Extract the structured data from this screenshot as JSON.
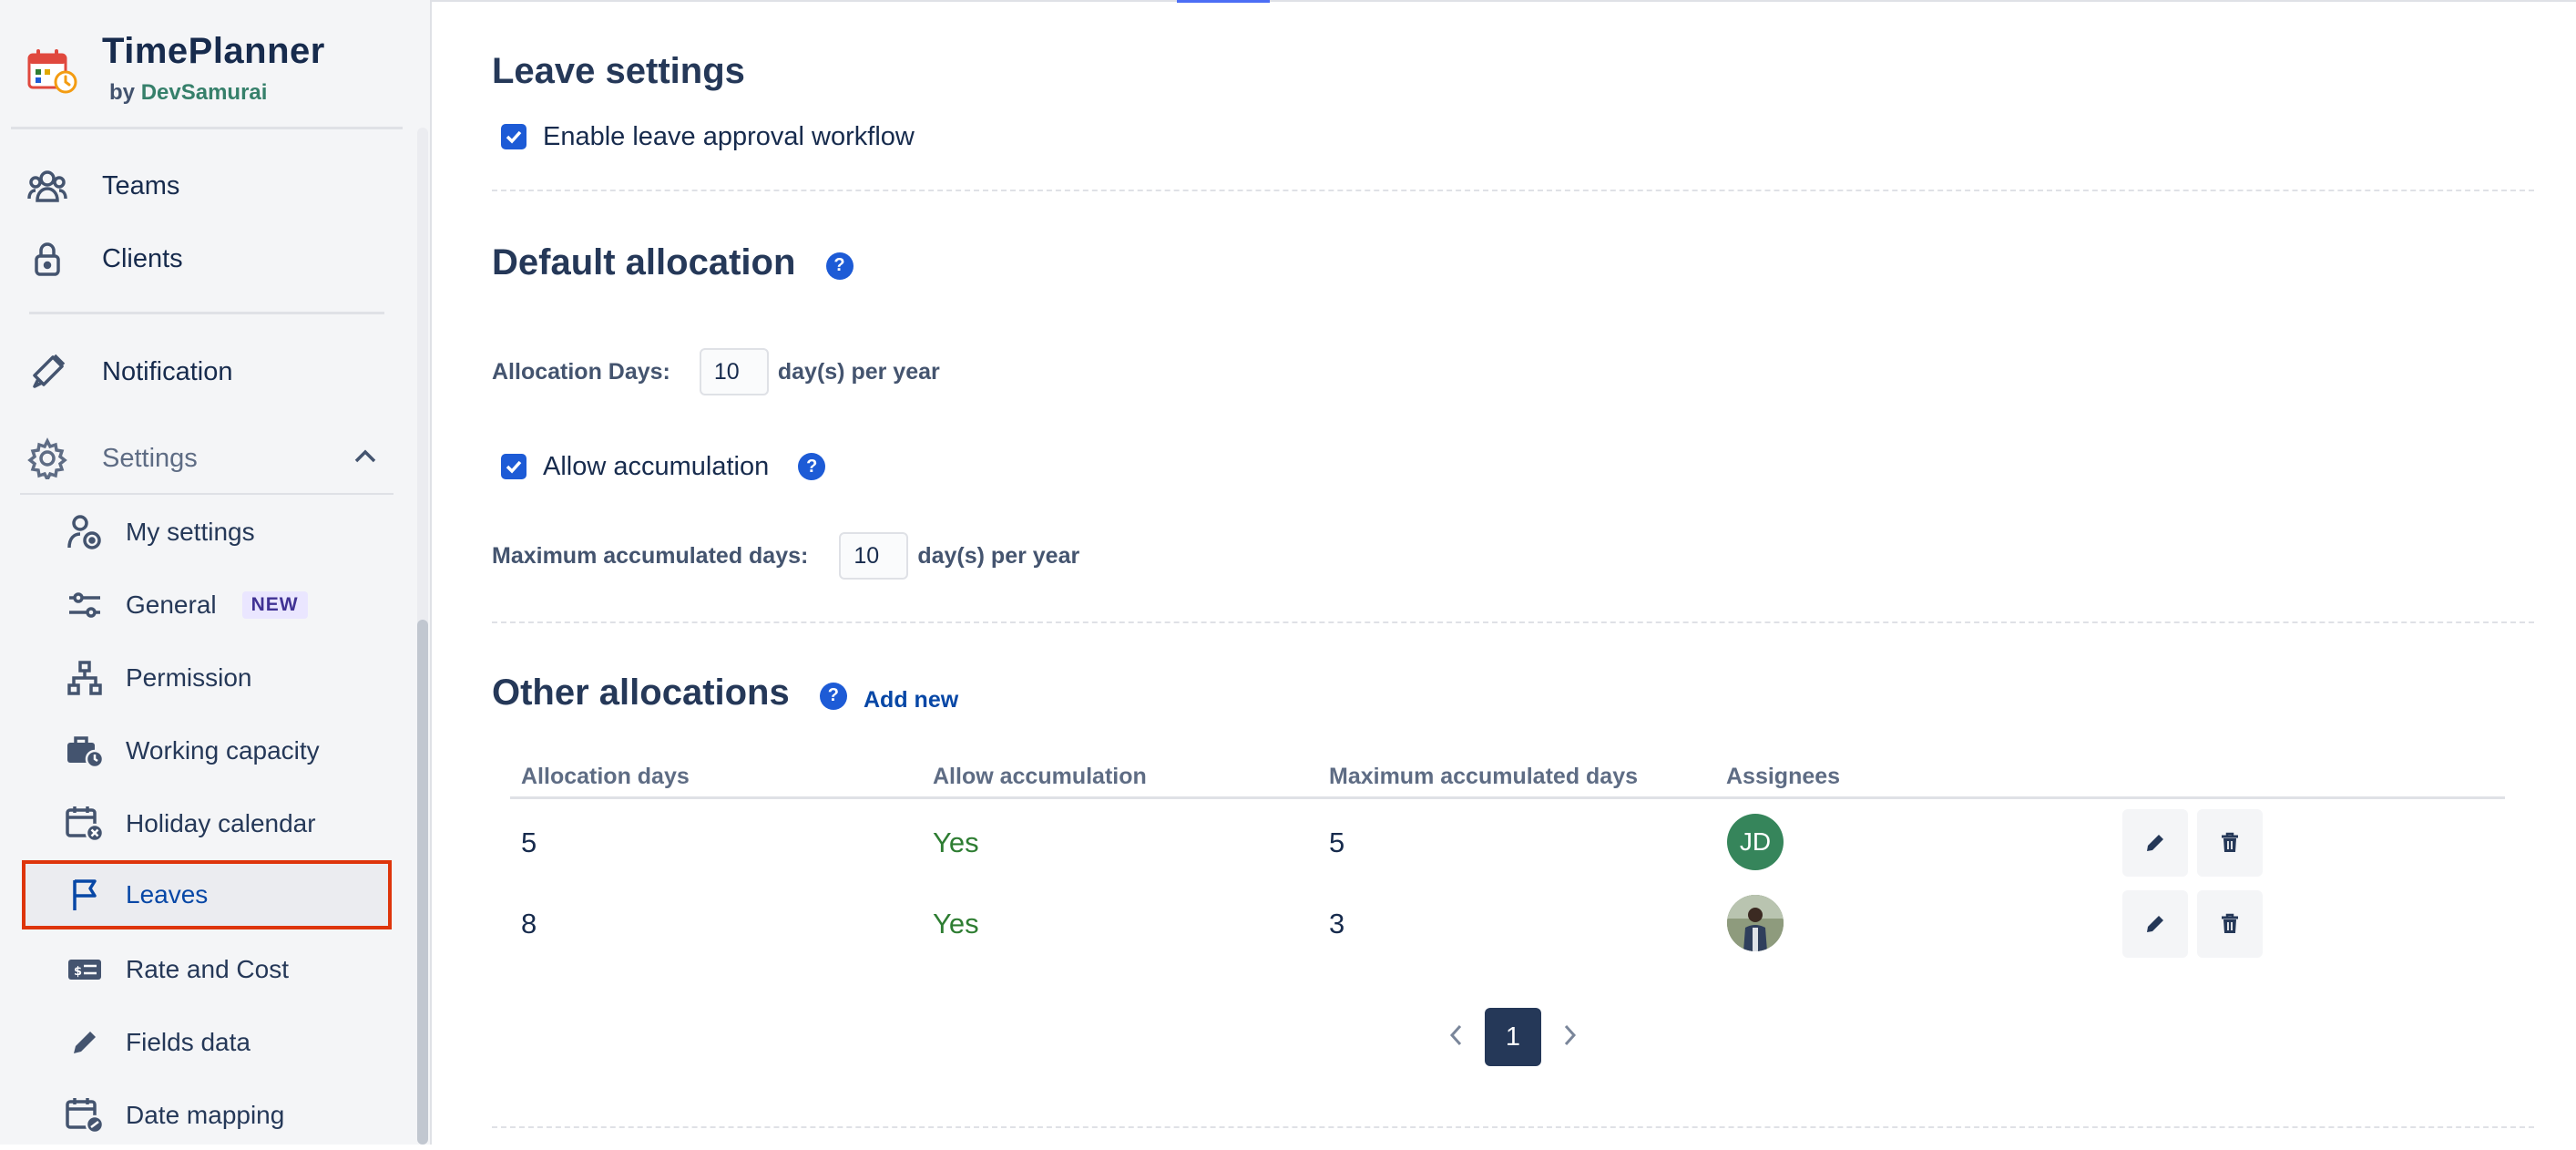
{
  "app": {
    "title": "TimePlanner",
    "by": "by",
    "vendor": "DevSamurai"
  },
  "sidebar": {
    "items": [
      {
        "label": "Teams",
        "icon": "teams-icon"
      },
      {
        "label": "Clients",
        "icon": "lock-icon"
      },
      {
        "label": "Notification",
        "icon": "megaphone-icon"
      },
      {
        "label": "Settings",
        "icon": "gear-icon",
        "expanded": true
      }
    ],
    "settings_items": [
      {
        "label": "My settings",
        "icon": "user-settings-icon"
      },
      {
        "label": "General",
        "icon": "sliders-icon",
        "badge": "NEW"
      },
      {
        "label": "Permission",
        "icon": "hierarchy-icon"
      },
      {
        "label": "Working capacity",
        "icon": "briefcase-clock-icon"
      },
      {
        "label": "Holiday calendar",
        "icon": "calendar-x-icon"
      },
      {
        "label": "Leaves",
        "icon": "flag-icon",
        "active": true
      },
      {
        "label": "Rate and Cost",
        "icon": "money-card-icon"
      },
      {
        "label": "Fields data",
        "icon": "pencil-icon"
      },
      {
        "label": "Date mapping",
        "icon": "calendar-link-icon"
      }
    ]
  },
  "leave_settings": {
    "title": "Leave settings",
    "approval_label": "Enable leave approval workflow",
    "approval_checked": true
  },
  "default_allocation": {
    "title": "Default allocation",
    "help": "?",
    "allocation_days_label": "Allocation Days:",
    "allocation_days_value": "10",
    "unit": "day(s) per year",
    "allow_accumulation_label": "Allow accumulation",
    "allow_accumulation_checked": true,
    "max_accumulated_label": "Maximum accumulated days:",
    "max_accumulated_value": "10"
  },
  "other_allocations": {
    "title": "Other allocations",
    "help": "?",
    "add_new": "Add new",
    "columns": [
      "Allocation days",
      "Allow accumulation",
      "Maximum accumulated days",
      "Assignees"
    ],
    "rows": [
      {
        "allocation_days": "5",
        "allow_accumulation": "Yes",
        "max_accumulated": "5",
        "assignee_initials": "JD",
        "assignee_type": "initials"
      },
      {
        "allocation_days": "8",
        "allow_accumulation": "Yes",
        "max_accumulated": "3",
        "assignee_initials": "",
        "assignee_type": "photo"
      }
    ]
  },
  "pagination": {
    "current": "1"
  },
  "colors": {
    "primary": "#1d5bd6",
    "active_outline": "#de350b",
    "yes_green": "#2e7d32",
    "avatar_green": "#36855b"
  }
}
